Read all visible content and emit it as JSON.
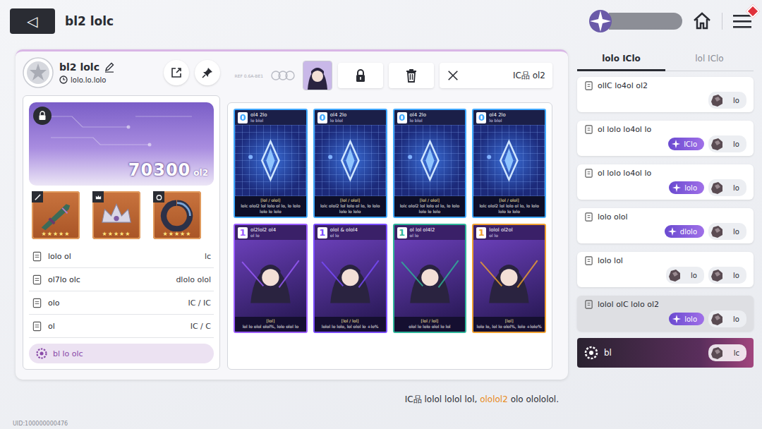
{
  "header": {
    "title": "bl2 lolc",
    "back_icon": "◁"
  },
  "top_right": {
    "menu_badge": true
  },
  "deck": {
    "name": "bl2 lolc",
    "date": "lolo.lo.lolo",
    "power": "70300",
    "power_unit": "ol2",
    "locked": true
  },
  "equipment": [
    {
      "slot": "weapon",
      "stars": 5
    },
    {
      "slot": "crown",
      "stars": 5
    },
    {
      "slot": "ring",
      "stars": 5
    }
  ],
  "star_glyph": "★",
  "stats": [
    {
      "label": "lolo ol",
      "value": "lc"
    },
    {
      "label": "ol7lo olc",
      "value": "dlolo olol"
    },
    {
      "label": "olo",
      "value": "IC / IC"
    },
    {
      "label": "ol",
      "value": "IC / C"
    }
  ],
  "skill_row": {
    "label": "bl lo olc"
  },
  "toolbar": {
    "tag": "REF 0.6A-BE1",
    "filter_label": "IC品 ol2"
  },
  "cards": [
    {
      "kind": "token",
      "cost": "0",
      "name": "ol4 2lo",
      "type": "lo blol",
      "tag": "[lol / olol]",
      "desc": "lolc olol2 lol lolo ol lo, lo lolo lolo lo lolo",
      "color": "#3fa9ff"
    },
    {
      "kind": "token",
      "cost": "0",
      "name": "ol4 2lo",
      "type": "lo blol",
      "tag": "[lol / olol]",
      "desc": "lolc olol2 lol lolo ol lo, lo lolo lolo lo lolo",
      "color": "#3fa9ff"
    },
    {
      "kind": "token",
      "cost": "0",
      "name": "ol4 2lo",
      "type": "lo blol",
      "tag": "[lol / olol]",
      "desc": "lolc olol2 lol lolo ol lo, lo lolo lolo lo lolo",
      "color": "#3fa9ff"
    },
    {
      "kind": "token",
      "cost": "0",
      "name": "ol4 2lo",
      "type": "lo blol",
      "tag": "[lol / olol]",
      "desc": "lolc olol2 lol lolo ol lo, lo lolo lolo lo lolo",
      "color": "#3fa9ff"
    },
    {
      "kind": "character",
      "cost": "1",
      "name": "ol2lol2 ol4",
      "type": "ol lo",
      "tag": "[lol]",
      "desc": "lol lo olol olol%, lolo olol lo",
      "color": "#9b5cff"
    },
    {
      "kind": "character",
      "cost": "1",
      "name": "olol & olol4",
      "type": "ol lo",
      "tag": "[lol / lol]",
      "desc": "lolol lo lolo, lol olol lo +lo%",
      "color": "#7a4cff"
    },
    {
      "kind": "character",
      "cost": "1",
      "name": "ol lol ol4l2",
      "type": "ol lo",
      "tag": "[lol / lol]",
      "desc": "olol lo lolo olol lo lol",
      "color": "#2fb59a"
    },
    {
      "kind": "character",
      "cost": "1",
      "name": "lolol ol2ol",
      "type": "ol lo",
      "tag": "[lol]",
      "desc": "lolo lo, lol lo olol%, lolo +lolo%",
      "color": "#f0a030"
    }
  ],
  "side_tabs": [
    {
      "label": "lolo IClo",
      "selected": true
    },
    {
      "label": "lol IClo",
      "selected": false
    }
  ],
  "side_entries": [
    {
      "title": "olIC lo4ol ol2",
      "pill": "",
      "selected": false,
      "items": [
        {
          "count": "lo"
        }
      ]
    },
    {
      "title": "ol lolo lo4ol lo",
      "pill": "IClo",
      "selected": false,
      "items": [
        {
          "count": "lo"
        }
      ]
    },
    {
      "title": "ol lolo lo4ol lo",
      "pill": "lolo",
      "selected": false,
      "items": [
        {
          "count": "lo"
        }
      ]
    },
    {
      "title": "lolo olol",
      "pill": "dlolo",
      "selected": false,
      "items": [
        {
          "count": "lo"
        }
      ]
    },
    {
      "title": "lolo lol",
      "pill": "",
      "selected": false,
      "items": [
        {
          "count": "lo"
        },
        {
          "count": "lo"
        }
      ]
    },
    {
      "title": "lolol olC lolo ol2",
      "pill": "lolo",
      "selected": true,
      "items": [
        {
          "count": "lo"
        }
      ]
    }
  ],
  "bottom_bar": {
    "label": "bl",
    "count": "lc"
  },
  "hint": {
    "text": "IC品 lolol lolol lol, ",
    "highlight": "ololol2",
    "tail": " olo olololol."
  },
  "uid": "UID:100000000476"
}
